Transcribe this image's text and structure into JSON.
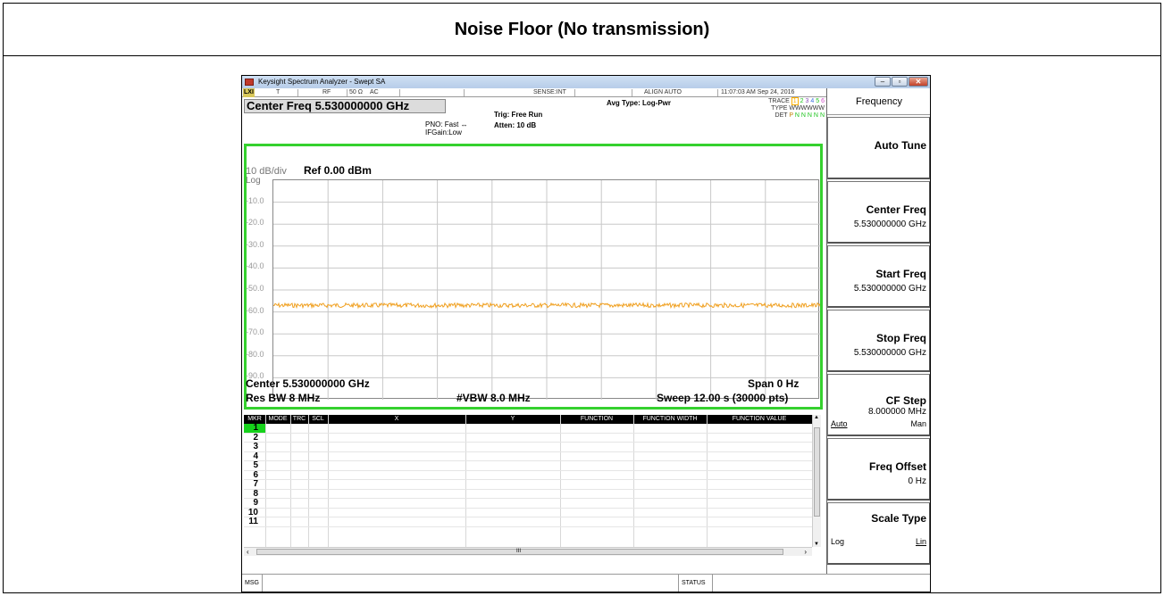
{
  "page_title": "Noise Floor (No transmission)",
  "window": {
    "title": "Keysight Spectrum Analyzer - Swept SA",
    "controls": {
      "minimize": "–",
      "maximize": "▫",
      "close": "✕"
    }
  },
  "status_row": {
    "lxi": "LXI",
    "t": "T",
    "rf": "RF",
    "impedance": "50 Ω",
    "coupling": "AC",
    "sense": "SENSE:INT",
    "align": "ALIGN AUTO",
    "datetime": "11:07:03 AM Sep 24, 2016"
  },
  "center_freq_banner": "Center Freq 5.530000000 GHz",
  "settings": {
    "pno": "PNO: Fast",
    "pno_arrow": "↔",
    "ifgain": "IFGain:Low",
    "trig": "Trig: Free Run",
    "atten": "Atten: 10 dB",
    "avg_type": "Avg Type: Log-Pwr"
  },
  "trace_info": {
    "trace_label": "TRACE",
    "trace_nums": [
      "1",
      "2",
      "3",
      "4",
      "5",
      "6"
    ],
    "type_label": "TYPE",
    "type_value": "WWWWWW",
    "det_label": "DET",
    "det_values": [
      "P",
      "N",
      "N",
      "N",
      "N",
      "N"
    ]
  },
  "plot": {
    "scale_per_div": "10 dB/div",
    "ref_level": "Ref 0.00 dBm",
    "scale_type": "Log",
    "y_labels": [
      "-10.0",
      "-20.0",
      "-30.0",
      "-40.0",
      "-50.0",
      "-60.0",
      "-70.0",
      "-80.0",
      "-90.0"
    ],
    "center": "Center 5.530000000 GHz",
    "span": "Span 0 Hz",
    "res_bw": "Res BW 8 MHz",
    "vbw": "#VBW 8.0 MHz",
    "sweep": "Sweep  12.00 s (30000 pts)",
    "trace_color": "#f0a020",
    "trace_level_dbm": -57
  },
  "marker_table": {
    "headers": [
      "MKR",
      "MODE",
      "TRC",
      "SCL",
      "X",
      "Y",
      "FUNCTION",
      "FUNCTION WIDTH",
      "FUNCTION VALUE"
    ],
    "rows": [
      "1",
      "2",
      "3",
      "4",
      "5",
      "6",
      "7",
      "8",
      "9",
      "10",
      "11"
    ],
    "selected_row": "1",
    "scroll_left": "‹",
    "scroll_right": "›",
    "scroll_up": "▲",
    "scroll_down": "▼",
    "scroll_center": "III"
  },
  "msgbar": {
    "msg": "MSG",
    "status": "STATUS"
  },
  "softkeys": {
    "menu_title": "Frequency",
    "auto_tune": "Auto Tune",
    "center_freq": {
      "label": "Center Freq",
      "value": "5.530000000 GHz"
    },
    "start_freq": {
      "label": "Start Freq",
      "value": "5.530000000 GHz"
    },
    "stop_freq": {
      "label": "Stop Freq",
      "value": "5.530000000 GHz"
    },
    "cf_step": {
      "label": "CF Step",
      "value": "8.000000 MHz",
      "left": "Auto",
      "right": "Man"
    },
    "freq_offset": {
      "label": "Freq Offset",
      "value": "0 Hz"
    },
    "scale_type": {
      "label": "Scale Type",
      "left": "Log",
      "right": "Lin"
    }
  }
}
